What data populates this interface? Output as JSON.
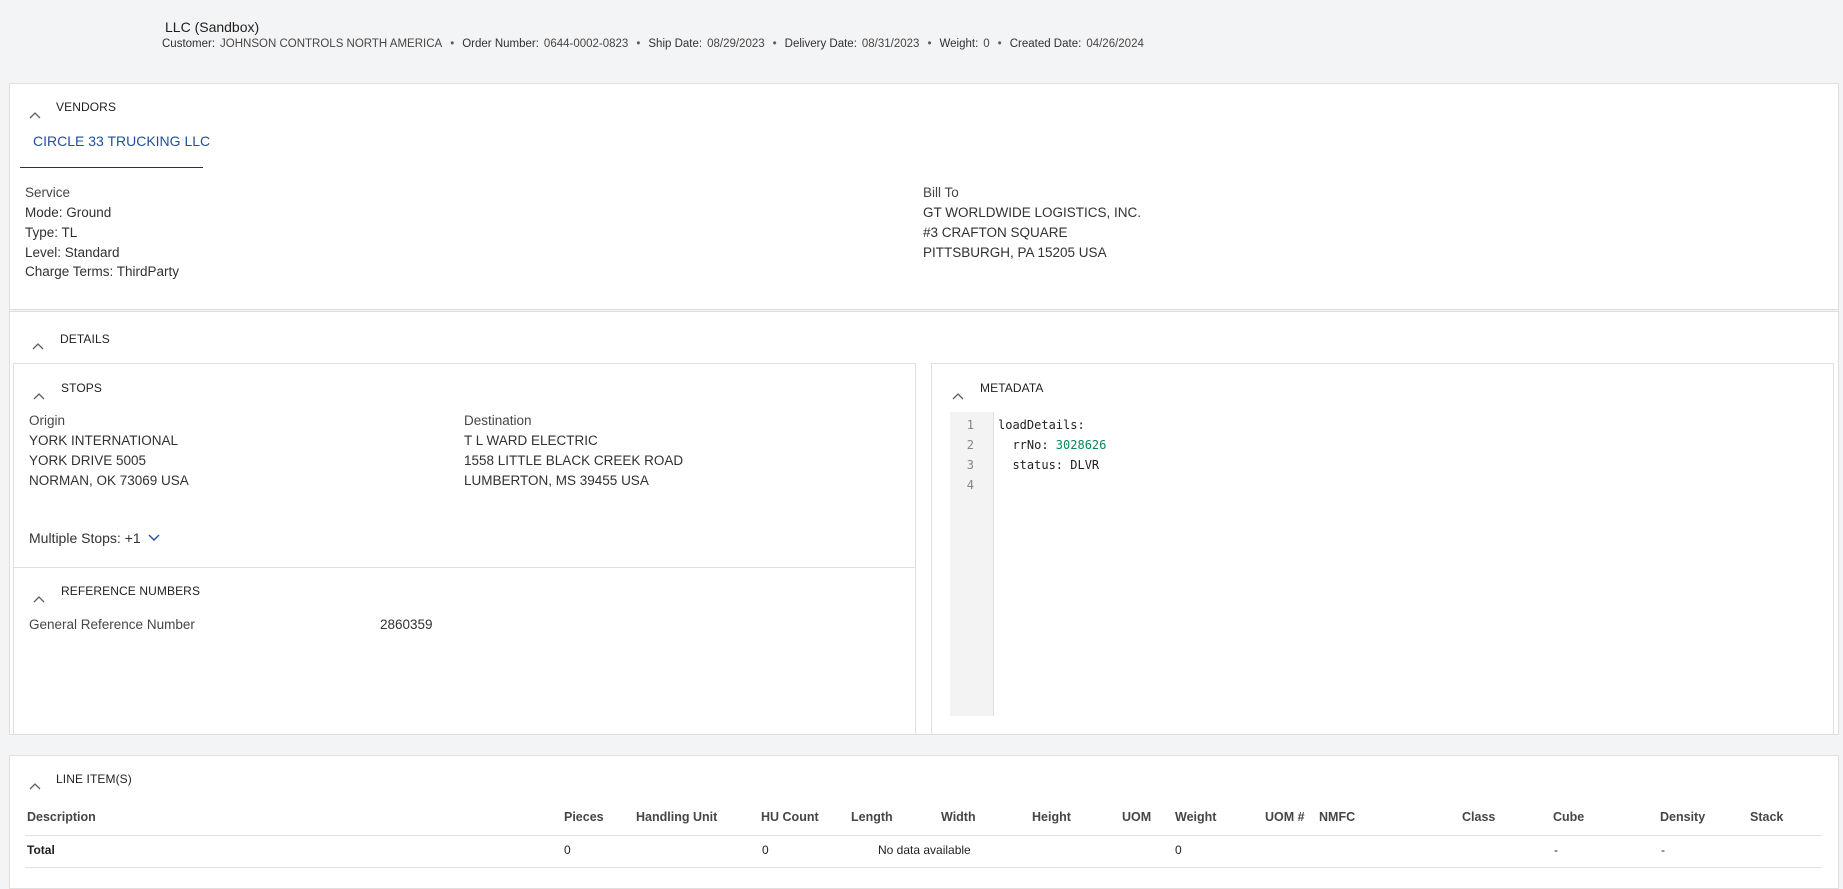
{
  "header": {
    "title": "LLC (Sandbox)",
    "meta": [
      {
        "label": "Customer:",
        "value": "JOHNSON CONTROLS NORTH AMERICA"
      },
      {
        "label": "Order Number:",
        "value": "0644-0002-0823"
      },
      {
        "label": "Ship Date:",
        "value": "08/29/2023"
      },
      {
        "label": "Delivery Date:",
        "value": "08/31/2023"
      },
      {
        "label": "Weight:",
        "value": "0"
      },
      {
        "label": "Created Date:",
        "value": "04/26/2024"
      }
    ],
    "separator": "•"
  },
  "vendors": {
    "title": "VENDORS",
    "tab": "CIRCLE 33 TRUCKING LLC",
    "service": {
      "heading": "Service",
      "lines": [
        "Mode: Ground",
        "Type: TL",
        "Level: Standard",
        "Charge Terms: ThirdParty"
      ]
    },
    "bill_to": {
      "heading": "Bill To",
      "lines": [
        "GT WORLDWIDE LOGISTICS, INC.",
        "#3 CRAFTON SQUARE",
        "PITTSBURGH, PA 15205 USA"
      ]
    }
  },
  "details": {
    "title": "DETAILS",
    "stops": {
      "title": "STOPS",
      "origin": {
        "heading": "Origin",
        "lines": [
          "YORK INTERNATIONAL",
          "YORK DRIVE 5005",
          "NORMAN, OK 73069 USA"
        ]
      },
      "destination": {
        "heading": "Destination",
        "lines": [
          "T L WARD ELECTRIC",
          "1558 LITTLE BLACK CREEK ROAD",
          "LUMBERTON, MS 39455 USA"
        ]
      },
      "multiple_stops": "Multiple Stops: +1"
    },
    "reference_numbers": {
      "title": "REFERENCE NUMBERS",
      "label": "General Reference Number",
      "value": "2860359"
    },
    "metadata": {
      "title": "METADATA",
      "line_numbers": [
        "1",
        "2",
        "3",
        "4"
      ],
      "code": [
        {
          "key": "loadDetails:",
          "value": ""
        },
        {
          "key": "  rrNo: ",
          "value": "3028626"
        },
        {
          "key": "  status: DLVR",
          "value": ""
        },
        {
          "key": "",
          "value": ""
        }
      ]
    }
  },
  "line_items": {
    "title": "LINE ITEM(S)",
    "columns": [
      "Description",
      "Pieces",
      "Handling Unit",
      "HU Count",
      "Length",
      "Width",
      "Height",
      "UOM",
      "Weight",
      "UOM #",
      "NMFC",
      "Class",
      "Cube",
      "Density",
      "Stack"
    ],
    "total_row": {
      "label": "Total",
      "pieces": "0",
      "hu_count": "0",
      "no_data": "No data available",
      "weight": "0",
      "cube": "-",
      "density": "-"
    }
  },
  "icons": {
    "collapse": "chevron-up-icon",
    "expand": "chevron-down-icon"
  }
}
